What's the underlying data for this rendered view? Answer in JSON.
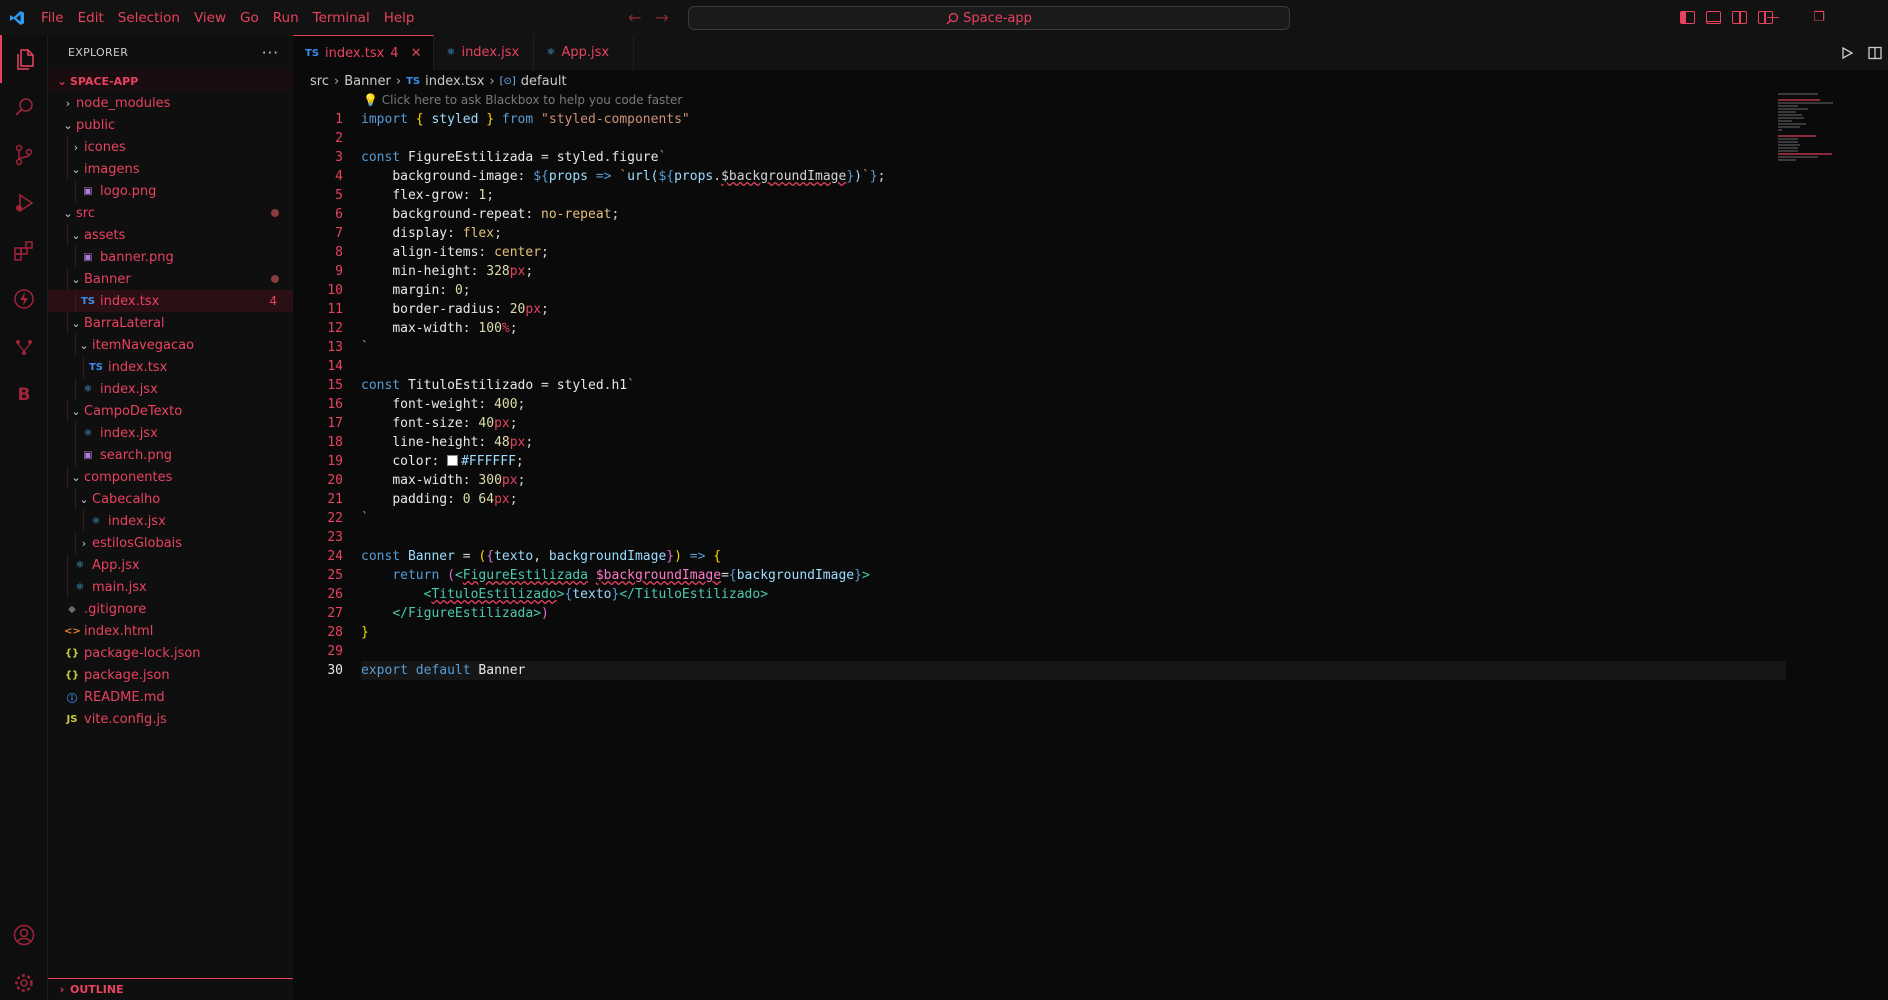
{
  "titlebar": {
    "menu": [
      "File",
      "Edit",
      "Selection",
      "View",
      "Go",
      "Run",
      "Terminal",
      "Help"
    ],
    "search_text": "Space-app"
  },
  "explorer": {
    "title": "EXPLORER",
    "root": "SPACE-APP",
    "tree": [
      {
        "label": "node_modules",
        "depth": 0,
        "chevron": "›",
        "icon": ""
      },
      {
        "label": "public",
        "depth": 0,
        "chevron": "⌄",
        "icon": ""
      },
      {
        "label": "icones",
        "depth": 1,
        "chevron": "›",
        "icon": ""
      },
      {
        "label": "imagens",
        "depth": 1,
        "chevron": "⌄",
        "icon": ""
      },
      {
        "label": "logo.png",
        "depth": 2,
        "chevron": "",
        "icon": "img"
      },
      {
        "label": "src",
        "depth": 0,
        "chevron": "⌄",
        "icon": "",
        "dot": true
      },
      {
        "label": "assets",
        "depth": 1,
        "chevron": "⌄",
        "icon": ""
      },
      {
        "label": "banner.png",
        "depth": 2,
        "chevron": "",
        "icon": "img"
      },
      {
        "label": "Banner",
        "depth": 1,
        "chevron": "⌄",
        "icon": "",
        "dot": true
      },
      {
        "label": "index.tsx",
        "depth": 2,
        "chevron": "",
        "icon": "TS",
        "badge": "4",
        "selected": true
      },
      {
        "label": "BarraLateral",
        "depth": 1,
        "chevron": "⌄",
        "icon": ""
      },
      {
        "label": "itemNavegacao",
        "depth": 2,
        "chevron": "⌄",
        "icon": ""
      },
      {
        "label": "index.tsx",
        "depth": 3,
        "chevron": "",
        "icon": "TS"
      },
      {
        "label": "index.jsx",
        "depth": 2,
        "chevron": "",
        "icon": "react"
      },
      {
        "label": "CampoDeTexto",
        "depth": 1,
        "chevron": "⌄",
        "icon": ""
      },
      {
        "label": "index.jsx",
        "depth": 2,
        "chevron": "",
        "icon": "react"
      },
      {
        "label": "search.png",
        "depth": 2,
        "chevron": "",
        "icon": "img"
      },
      {
        "label": "componentes",
        "depth": 1,
        "chevron": "⌄",
        "icon": ""
      },
      {
        "label": "Cabecalho",
        "depth": 2,
        "chevron": "⌄",
        "icon": ""
      },
      {
        "label": "index.jsx",
        "depth": 3,
        "chevron": "",
        "icon": "react"
      },
      {
        "label": "estilosGlobais",
        "depth": 2,
        "chevron": "›",
        "icon": ""
      },
      {
        "label": "App.jsx",
        "depth": 1,
        "chevron": "",
        "icon": "react"
      },
      {
        "label": "main.jsx",
        "depth": 1,
        "chevron": "",
        "icon": "react"
      },
      {
        "label": ".gitignore",
        "depth": 0,
        "chevron": "",
        "icon": "git"
      },
      {
        "label": "index.html",
        "depth": 0,
        "chevron": "",
        "icon": "html"
      },
      {
        "label": "package-lock.json",
        "depth": 0,
        "chevron": "",
        "icon": "json"
      },
      {
        "label": "package.json",
        "depth": 0,
        "chevron": "",
        "icon": "json"
      },
      {
        "label": "README.md",
        "depth": 0,
        "chevron": "",
        "icon": "info"
      },
      {
        "label": "vite.config.js",
        "depth": 0,
        "chevron": "",
        "icon": "JS"
      }
    ],
    "outline": "OUTLINE"
  },
  "tabs": [
    {
      "label": "index.tsx",
      "icon": "TS",
      "badge": "4",
      "active": true
    },
    {
      "label": "index.jsx",
      "icon": "react"
    },
    {
      "label": "App.jsx",
      "icon": "react"
    }
  ],
  "breadcrumb": [
    "src",
    "Banner",
    "index.tsx",
    "default"
  ],
  "codelens": "Click here to ask Blackbox to help you code faster",
  "current_line": 30,
  "colors": {
    "accent": "#e8425f",
    "background": "#0a0a0a"
  }
}
